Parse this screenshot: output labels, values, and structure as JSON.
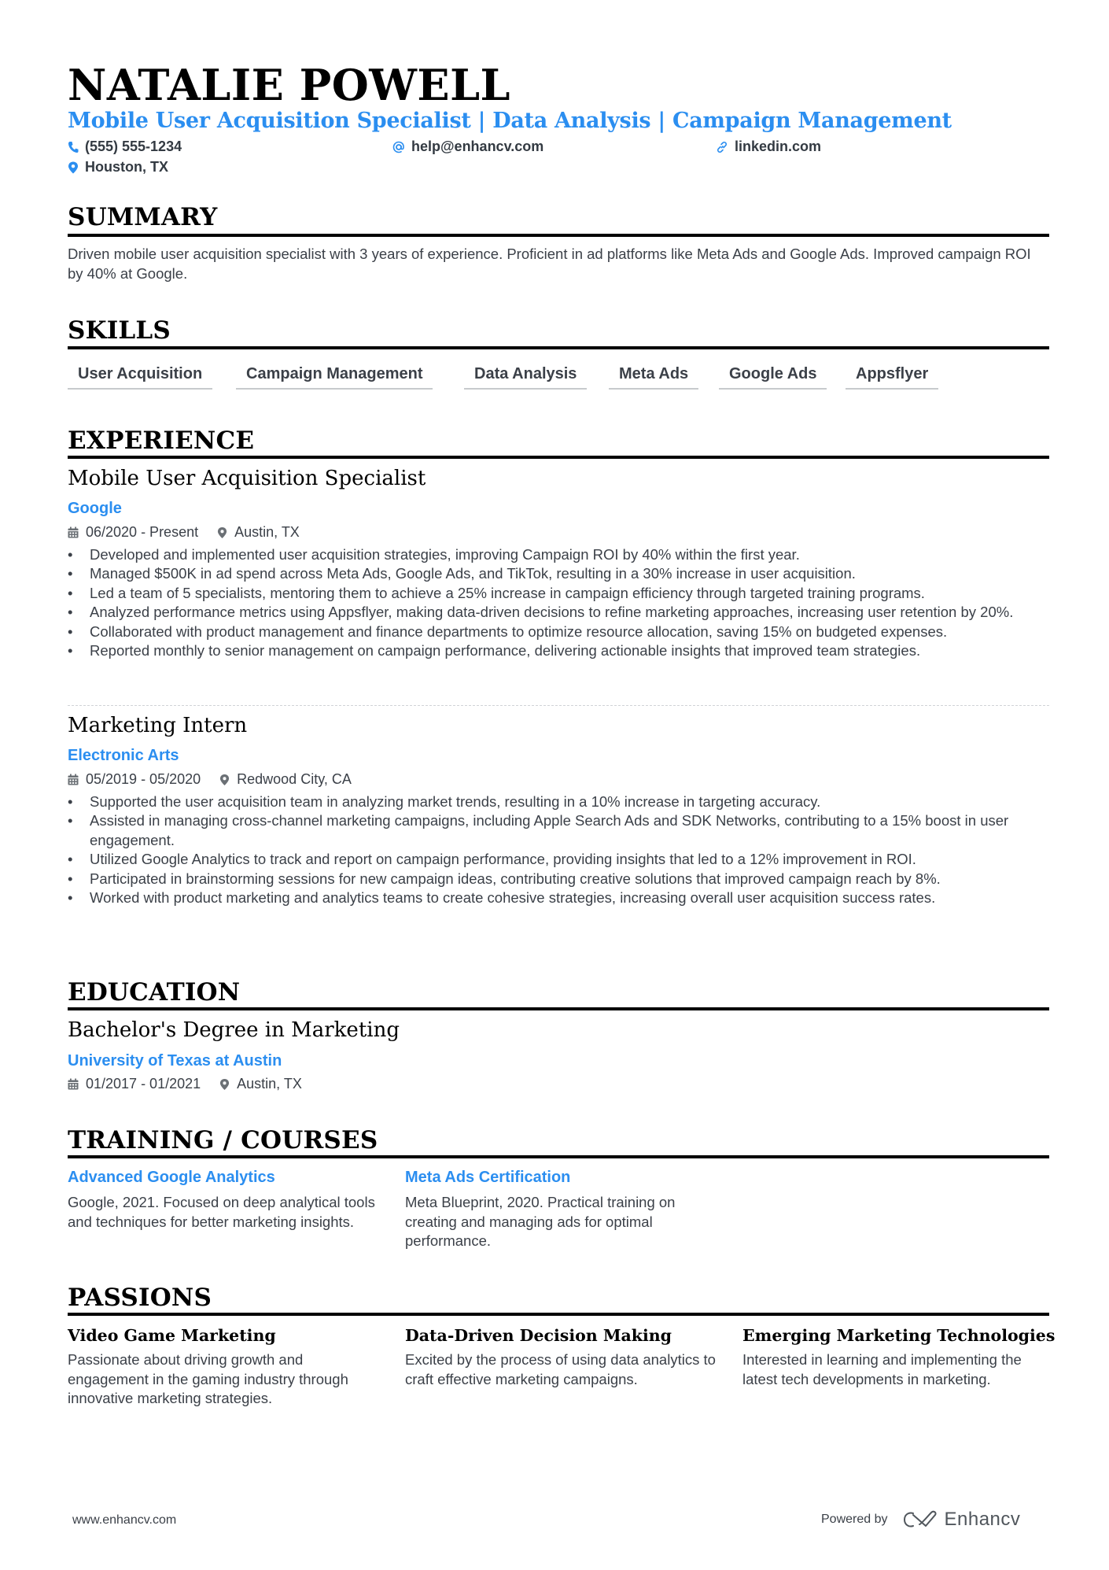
{
  "header": {
    "name": "NATALIE POWELL",
    "title": "Mobile User Acquisition Specialist | Data Analysis | Campaign Management",
    "contacts": {
      "phone": {
        "icon": "phone-icon",
        "value": "(555) 555-1234"
      },
      "email": {
        "icon": "at-icon",
        "value": "help@enhancv.com"
      },
      "linkedin": {
        "icon": "link-icon",
        "value": "linkedin.com"
      },
      "location": {
        "icon": "location-pin-icon",
        "value": "Houston, TX"
      }
    }
  },
  "colors": {
    "accent": "#2b8ef0",
    "text": "#3b4048",
    "heading": "#000000"
  },
  "summary": {
    "heading": "SUMMARY",
    "text": "Driven mobile user acquisition specialist with 3 years of experience. Proficient in ad platforms like Meta Ads and Google Ads. Improved campaign ROI by 40% at Google."
  },
  "skills": {
    "heading": "SKILLS",
    "items": [
      "User Acquisition",
      "Campaign Management",
      "Data Analysis",
      "Meta Ads",
      "Google Ads",
      "Appsflyer"
    ]
  },
  "experience": {
    "heading": "EXPERIENCE",
    "jobs": [
      {
        "title": "Mobile User Acquisition Specialist",
        "company": "Google",
        "dates": "06/2020 - Present",
        "location": "Austin, TX",
        "bullets": [
          "Developed and implemented user acquisition strategies, improving Campaign ROI by 40% within the first year.",
          "Managed $500K in ad spend across Meta Ads, Google Ads, and TikTok, resulting in a 30% increase in user acquisition.",
          "Led a team of 5 specialists, mentoring them to achieve a 25% increase in campaign efficiency through targeted training programs.",
          "Analyzed performance metrics using Appsflyer, making data-driven decisions to refine marketing approaches, increasing user retention by 20%.",
          "Collaborated with product management and finance departments to optimize resource allocation, saving 15% on budgeted expenses.",
          "Reported monthly to senior management on campaign performance, delivering actionable insights that improved team strategies."
        ]
      },
      {
        "title": "Marketing Intern",
        "company": "Electronic Arts",
        "dates": "05/2019 - 05/2020",
        "location": "Redwood City, CA",
        "bullets": [
          "Supported the user acquisition team in analyzing market trends, resulting in a 10% increase in targeting accuracy.",
          "Assisted in managing cross-channel marketing campaigns, including Apple Search Ads and SDK Networks, contributing to a 15% boost in user engagement.",
          "Utilized Google Analytics to track and report on campaign performance, providing insights that led to a 12% improvement in ROI.",
          "Participated in brainstorming sessions for new campaign ideas, contributing creative solutions that improved campaign reach by 8%.",
          "Worked with product marketing and analytics teams to create cohesive strategies, increasing overall user acquisition success rates."
        ]
      }
    ]
  },
  "education": {
    "heading": "EDUCATION",
    "items": [
      {
        "degree": "Bachelor's Degree in Marketing",
        "school": "University of Texas at Austin",
        "dates": "01/2017 - 01/2021",
        "location": "Austin, TX"
      }
    ]
  },
  "training": {
    "heading": "TRAINING / COURSES",
    "items": [
      {
        "title": "Advanced Google Analytics",
        "description": "Google, 2021. Focused on deep analytical tools and techniques for better marketing insights."
      },
      {
        "title": "Meta Ads Certification",
        "description": "Meta Blueprint, 2020. Practical training on creating and managing ads for optimal performance."
      }
    ]
  },
  "passions": {
    "heading": "PASSIONS",
    "items": [
      {
        "title": "Video Game Marketing",
        "description": "Passionate about driving growth and engagement in the gaming industry through innovative marketing strategies."
      },
      {
        "title": "Data-Driven Decision Making",
        "description": "Excited by the process of using data analytics to craft effective marketing campaigns."
      },
      {
        "title": "Emerging Marketing Technologies",
        "description": "Interested in learning and implementing the latest tech developments in marketing."
      }
    ]
  },
  "footer": {
    "website": "www.enhancv.com",
    "powered_by": "Powered by",
    "brand": "Enhancv",
    "brand_icon": "enhancv-logo-icon"
  }
}
